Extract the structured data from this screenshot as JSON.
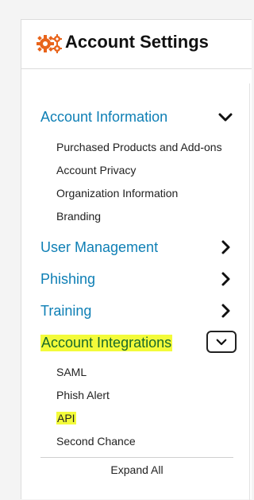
{
  "header": {
    "title": "Account Settings",
    "icon": "gears-icon",
    "icon_color": "#e8641b"
  },
  "nav": {
    "sections": [
      {
        "label": "Account Information",
        "state": "expanded",
        "items": [
          "Purchased Products and Add-ons",
          "Account Privacy",
          "Organization Information",
          "Branding"
        ]
      },
      {
        "label": "User Management",
        "state": "collapsed"
      },
      {
        "label": "Phishing",
        "state": "collapsed"
      },
      {
        "label": "Training",
        "state": "collapsed"
      },
      {
        "label": "Account Integrations",
        "state": "expanded",
        "highlighted": true,
        "items": [
          "SAML",
          "Phish Alert",
          "API",
          "Second Chance"
        ],
        "highlighted_item": "API"
      }
    ],
    "expand_all": "Expand All"
  },
  "colors": {
    "link": "#0e7fb5",
    "highlight": "#f3fb3a"
  }
}
